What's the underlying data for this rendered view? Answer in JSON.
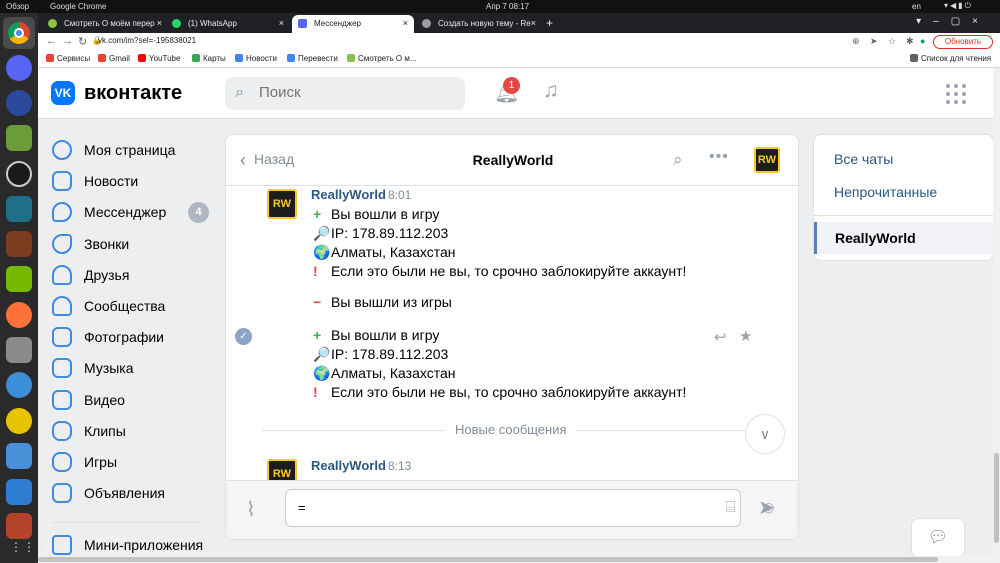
{
  "topbar": {
    "activities": "Обзор",
    "app": "Google Chrome",
    "clock": "Апр 7  08:17",
    "lang": "en"
  },
  "browser": {
    "tabs": [
      {
        "title": "Смотреть О моём перер",
        "icon": "youtube-like-icon"
      },
      {
        "title": "(1) WhatsApp",
        "icon": "whatsapp-icon"
      },
      {
        "title": "Мессенджер",
        "icon": "vk-icon"
      },
      {
        "title": "Создать новую тему - Re",
        "icon": "forum-icon"
      }
    ],
    "new_tab": "+",
    "url": "vk.com/im?sel=-195838021",
    "update_button": "Обновить",
    "bookmarks": [
      "Сервисы",
      "Gmail",
      "YouTube",
      "Карты",
      "Новости",
      "Перевести",
      "Смотреть О м..."
    ],
    "reading_list": "Список для чтения"
  },
  "vk": {
    "logo_text": "VK",
    "brand": "вконтакте",
    "search_placeholder": "Поиск",
    "notifications_count": "1",
    "nav": [
      {
        "label": "Моя страница",
        "icon": "user-icon"
      },
      {
        "label": "Новости",
        "icon": "news-icon"
      },
      {
        "label": "Мессенджер",
        "icon": "message-icon",
        "count": "4"
      },
      {
        "label": "Звонки",
        "icon": "phone-icon"
      },
      {
        "label": "Друзья",
        "icon": "friends-icon"
      },
      {
        "label": "Сообщества",
        "icon": "communities-icon"
      },
      {
        "label": "Фотографии",
        "icon": "photo-icon"
      },
      {
        "label": "Музыка",
        "icon": "music-icon"
      },
      {
        "label": "Видео",
        "icon": "video-icon"
      },
      {
        "label": "Клипы",
        "icon": "clips-icon"
      },
      {
        "label": "Игры",
        "icon": "games-icon"
      },
      {
        "label": "Объявления",
        "icon": "ads-icon"
      },
      {
        "label": "Мини-приложения",
        "icon": "apps-icon"
      }
    ],
    "chat": {
      "back": "Назад",
      "title": "ReallyWorld",
      "avatar_text": "RW",
      "messages": [
        {
          "name": "ReallyWorld",
          "time": "8:01",
          "lines": [
            {
              "emoji": "+",
              "text": "Вы вошли в игру"
            },
            {
              "emoji": "🔎",
              "text": "IP: 178.89.112.203"
            },
            {
              "emoji": "🌍",
              "text": "Алматы, Казахстан"
            },
            {
              "emoji": "!",
              "text": "Если это были не вы, то срочно заблокируйте аккаунт!"
            },
            {
              "emoji": "−",
              "text": "Вы вышли из игры"
            },
            {
              "emoji": "+",
              "text": "Вы вошли в игру"
            },
            {
              "emoji": "🔎",
              "text": "IP: 178.89.112.203"
            },
            {
              "emoji": "🌍",
              "text": "Алматы, Казахстан"
            },
            {
              "emoji": "!",
              "text": "Если это были не вы, то срочно заблокируйте аккаунт!"
            }
          ]
        },
        {
          "name": "ReallyWorld",
          "time": "8:13"
        }
      ],
      "new_messages_label": "Новые сообщения",
      "input_value": "="
    },
    "right_panel": {
      "all_chats": "Все чаты",
      "unread": "Непрочитанные",
      "active_chat": "ReallyWorld"
    }
  },
  "colors": {
    "vk_blue": "#0077ff",
    "link": "#2a5885",
    "badge_red": "#e64646",
    "rw_yellow": "#f6c72b"
  }
}
